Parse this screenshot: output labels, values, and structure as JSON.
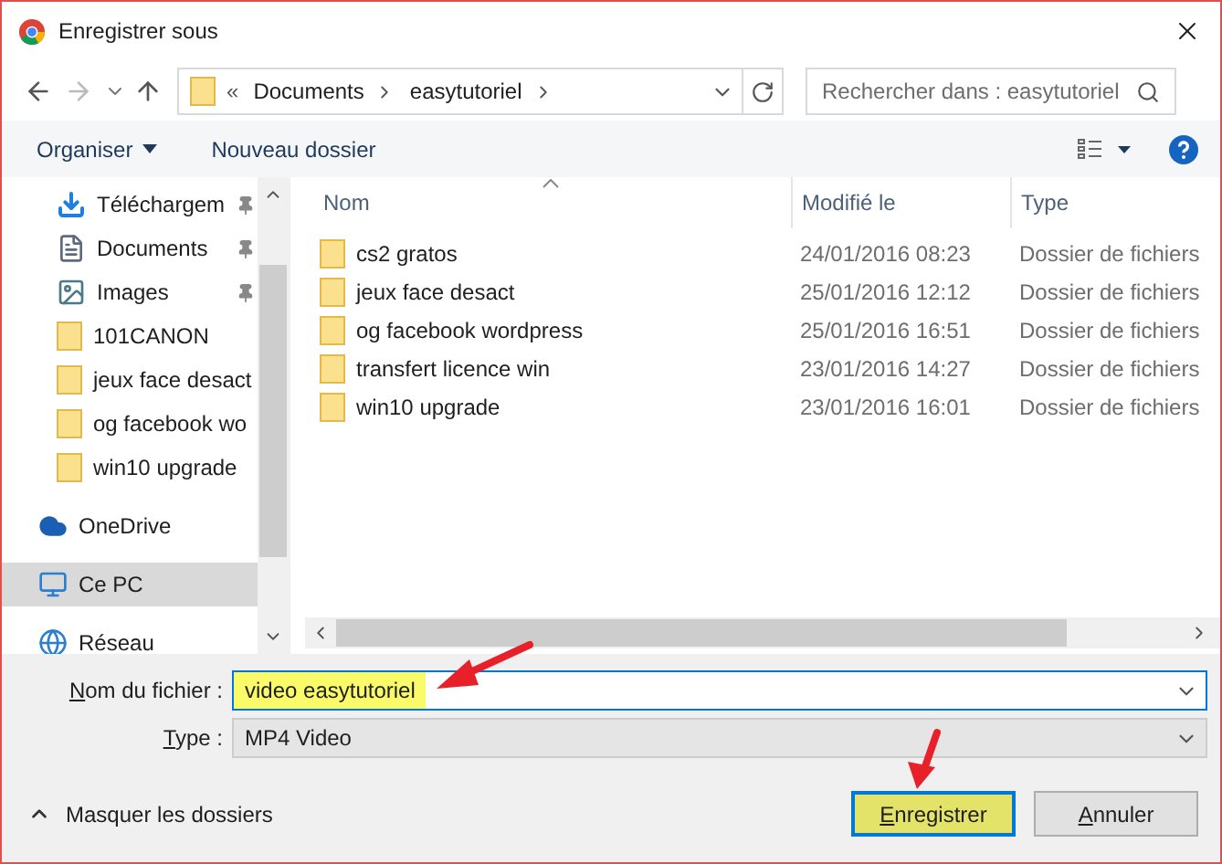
{
  "window": {
    "title": "Enregistrer sous"
  },
  "address": {
    "breadcrumbs": [
      "Documents",
      "easytutoriel"
    ],
    "overflow": "«"
  },
  "search": {
    "placeholder": "Rechercher dans : easytutoriel"
  },
  "toolbar": {
    "organize": "Organiser",
    "new_folder": "Nouveau dossier"
  },
  "nav_sections": [
    {
      "items": [
        {
          "kind": "download",
          "label": "Téléchargem",
          "pinned": true,
          "selected": false
        },
        {
          "kind": "document",
          "label": "Documents",
          "pinned": true,
          "selected": false
        },
        {
          "kind": "images",
          "label": "Images",
          "pinned": true,
          "selected": false
        },
        {
          "kind": "folder",
          "label": "101CANON",
          "pinned": false,
          "selected": false
        },
        {
          "kind": "folder",
          "label": "jeux face desact",
          "pinned": false,
          "selected": false
        },
        {
          "kind": "folder",
          "label": "og facebook wo",
          "pinned": false,
          "selected": false
        },
        {
          "kind": "folder",
          "label": "win10 upgrade",
          "pinned": false,
          "selected": false
        }
      ]
    },
    {
      "items": [
        {
          "kind": "onedrive",
          "label": "OneDrive",
          "pinned": false,
          "selected": false
        }
      ]
    },
    {
      "items": [
        {
          "kind": "pc",
          "label": "Ce PC",
          "pinned": false,
          "selected": true
        }
      ]
    },
    {
      "items": [
        {
          "kind": "network",
          "label": "Réseau",
          "pinned": false,
          "selected": false
        }
      ]
    }
  ],
  "table": {
    "columns": [
      "Nom",
      "Modifié le",
      "Type"
    ],
    "rows": [
      {
        "name": "cs2 gratos",
        "modified": "24/01/2016 08:23",
        "type": "Dossier de fichiers"
      },
      {
        "name": "jeux face desact",
        "modified": "25/01/2016 12:12",
        "type": "Dossier de fichiers"
      },
      {
        "name": "og facebook wordpress",
        "modified": "25/01/2016 16:51",
        "type": "Dossier de fichiers"
      },
      {
        "name": "transfert licence win",
        "modified": "23/01/2016 14:27",
        "type": "Dossier de fichiers"
      },
      {
        "name": "win10 upgrade",
        "modified": "23/01/2016 16:01",
        "type": "Dossier de fichiers"
      }
    ]
  },
  "filename": {
    "label": "Nom du fichier :",
    "value": "video easytutoriel",
    "highlighted": true
  },
  "filetype": {
    "label": "Type :",
    "value": "MP4 Video"
  },
  "hide_folders": "Masquer les dossiers",
  "buttons": [
    {
      "label": "Enregistrer",
      "highlighted": true
    },
    {
      "label": "Annuler",
      "highlighted": false
    }
  ]
}
